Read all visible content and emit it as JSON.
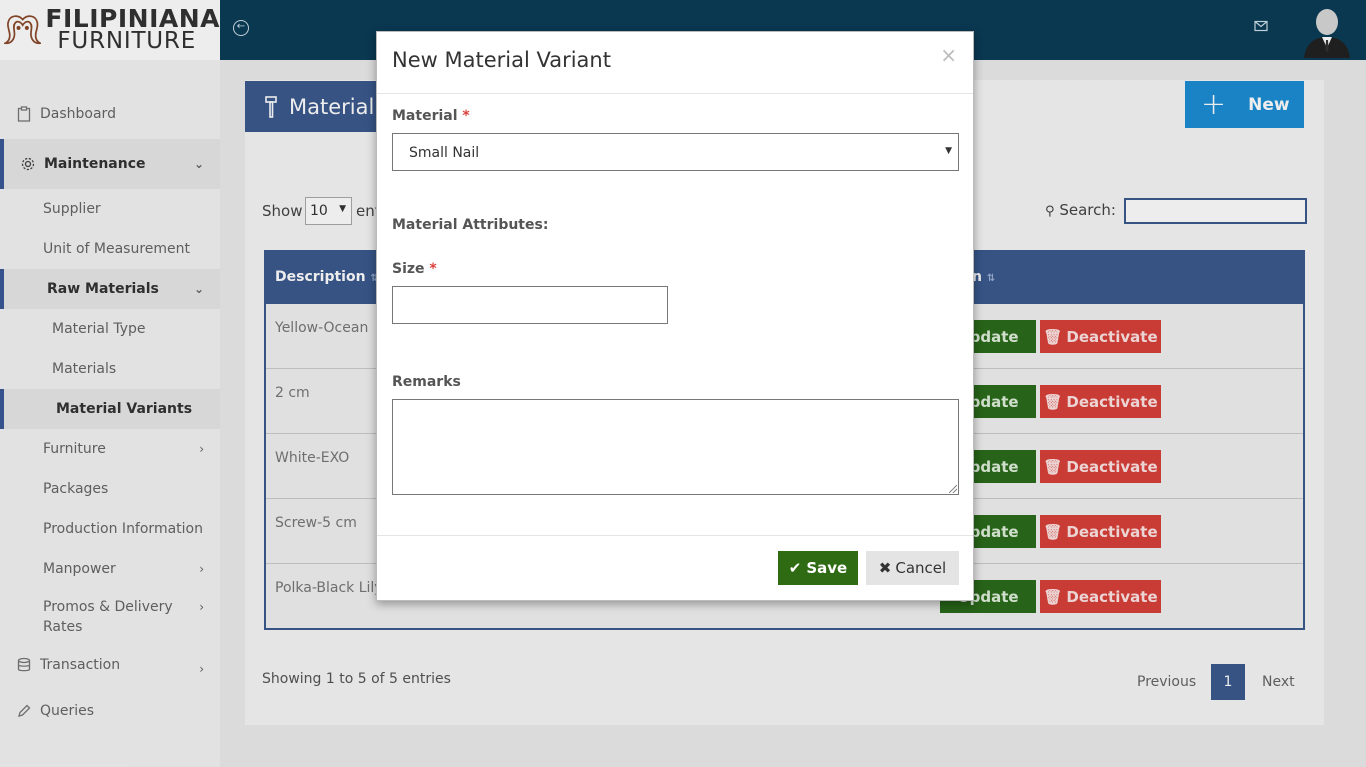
{
  "brand": {
    "line1": "FILIPINIANA",
    "line2": "FURNITURE"
  },
  "sidebar": {
    "items": [
      {
        "label": "Dashboard"
      },
      {
        "label": "Maintenance"
      },
      {
        "label": "Supplier"
      },
      {
        "label": "Unit of Measurement"
      },
      {
        "label": "Raw Materials"
      },
      {
        "label": "Material Type"
      },
      {
        "label": "Materials"
      },
      {
        "label": "Material Variants"
      },
      {
        "label": "Furniture"
      },
      {
        "label": "Packages"
      },
      {
        "label": "Production Information"
      },
      {
        "label": "Manpower"
      },
      {
        "label": "Promos & Delivery Rates"
      },
      {
        "label": "Transaction"
      },
      {
        "label": "Queries"
      }
    ]
  },
  "page": {
    "title": "Material",
    "new_label": "New"
  },
  "table_controls": {
    "show_label": "Show",
    "entries_suffix": "ent",
    "page_size": "10",
    "search_label": "Search:"
  },
  "table": {
    "headers": [
      "Description",
      "n"
    ],
    "rows": [
      {
        "description": "Yellow-Ocean"
      },
      {
        "description": "2 cm"
      },
      {
        "description": "White-EXO"
      },
      {
        "description": "Screw-5 cm"
      },
      {
        "description": "Polka-Black Lily"
      }
    ],
    "update_label": "Update",
    "deactivate_label": "Deactivate",
    "info": "Showing 1 to 5 of 5 entries",
    "pager": {
      "previous": "Previous",
      "current": "1",
      "next": "Next"
    }
  },
  "modal": {
    "title": "New Material Variant",
    "close": "×",
    "material_label": "Material",
    "material_value": "Small Nail",
    "attributes_label": "Material Attributes:",
    "size_label": "Size",
    "size_value": "",
    "remarks_label": "Remarks",
    "remarks_value": "",
    "required_mark": "*",
    "save_label": "Save",
    "cancel_label": "Cancel"
  },
  "colors": {
    "topbar": "#0b3d57",
    "header": "#3b5a8e",
    "new_button": "#1d8dd5",
    "update": "#2a6b1a",
    "deactivate": "#d9403a",
    "save": "#2f6b12"
  }
}
